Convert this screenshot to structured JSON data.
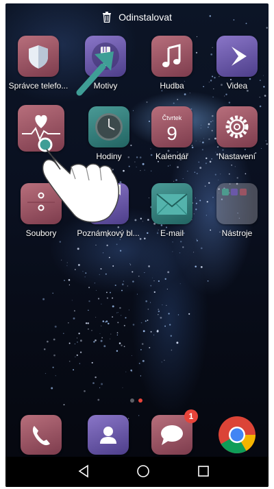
{
  "top_bar": {
    "uninstall_label": "Odinstalovat"
  },
  "apps": [
    {
      "label": "Správce telefo..."
    },
    {
      "label": "Motivy"
    },
    {
      "label": "Hudba"
    },
    {
      "label": "Videa"
    },
    {
      "label": ""
    },
    {
      "label": "Hodiny"
    },
    {
      "label": "Kalendář"
    },
    {
      "label": "Nastavení"
    },
    {
      "label": "Soubory"
    },
    {
      "label": "Poznámkový bl..."
    },
    {
      "label": "E-mail"
    },
    {
      "label": "Nástroje"
    }
  ],
  "calendar": {
    "weekday": "Čtvrtek",
    "day": "9"
  },
  "dock": {
    "messages_badge": "1"
  },
  "page_indicator": {
    "pages": 2,
    "current": 2
  },
  "colors": {
    "accent_mauve": "#9a5463",
    "purple": "#6a58a8",
    "teal": "#2f7c79",
    "badge_red": "#e7443a",
    "arrow": "#3f9e96"
  }
}
